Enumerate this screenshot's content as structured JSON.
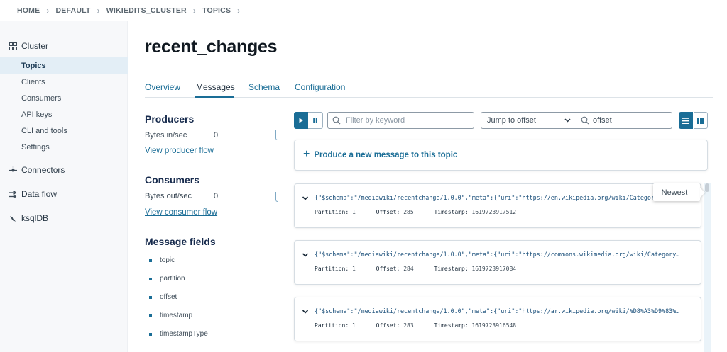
{
  "breadcrumb": [
    "HOME",
    "DEFAULT",
    "WIKIEDITS_CLUSTER",
    "TOPICS"
  ],
  "sidebar": {
    "cluster_label": "Cluster",
    "cluster_items": [
      "Topics",
      "Clients",
      "Consumers",
      "API keys",
      "CLI and tools",
      "Settings"
    ],
    "active_item": "Topics",
    "connectors_label": "Connectors",
    "dataflow_label": "Data flow",
    "ksqldb_label": "ksqlDB"
  },
  "page_title": "recent_changes",
  "tabs": [
    "Overview",
    "Messages",
    "Schema",
    "Configuration"
  ],
  "active_tab": "Messages",
  "producers": {
    "heading": "Producers",
    "metric_label": "Bytes in/sec",
    "metric_value": "0",
    "link": "View producer flow"
  },
  "consumers": {
    "heading": "Consumers",
    "metric_label": "Bytes out/sec",
    "metric_value": "0",
    "link": "View consumer flow"
  },
  "message_fields": {
    "heading": "Message fields",
    "fields": [
      "topic",
      "partition",
      "offset",
      "timestamp",
      "timestampType"
    ]
  },
  "toolbar": {
    "filter_placeholder": "Filter by keyword",
    "jump_select_value": "Jump to offset",
    "offset_value": "offset"
  },
  "produce_label": "Produce a new message to this topic",
  "newest_tooltip": "Newest",
  "meta_labels": {
    "partition": "Partition:",
    "offset": "Offset:",
    "timestamp": "Timestamp:"
  },
  "messages": [
    {
      "json": "{\"$schema\":\"/mediawiki/recentchange/1.0.0\",\"meta\":{\"uri\":\"https://en.wikipedia.org/wiki/Category",
      "partition": "1",
      "offset": "285",
      "timestamp": "1619723917512"
    },
    {
      "json": "{\"$schema\":\"/mediawiki/recentchange/1.0.0\",\"meta\":{\"uri\":\"https://commons.wikimedia.org/wiki/Category…",
      "partition": "1",
      "offset": "284",
      "timestamp": "1619723917084"
    },
    {
      "json": "{\"$schema\":\"/mediawiki/recentchange/1.0.0\",\"meta\":{\"uri\":\"https://ar.wikipedia.org/wiki/%D8%A3%D9%83%…",
      "partition": "1",
      "offset": "283",
      "timestamp": "1619723916548"
    }
  ],
  "colors": {
    "accent": "#1a6d96",
    "sidebar_bg": "#f7f8fa",
    "active_nav_bg": "#e3eef6"
  },
  "icons": {
    "cluster": "grid-icon",
    "connectors": "connectors-icon",
    "dataflow": "dataflow-icon",
    "ksqldb": "ksqldb-icon"
  }
}
